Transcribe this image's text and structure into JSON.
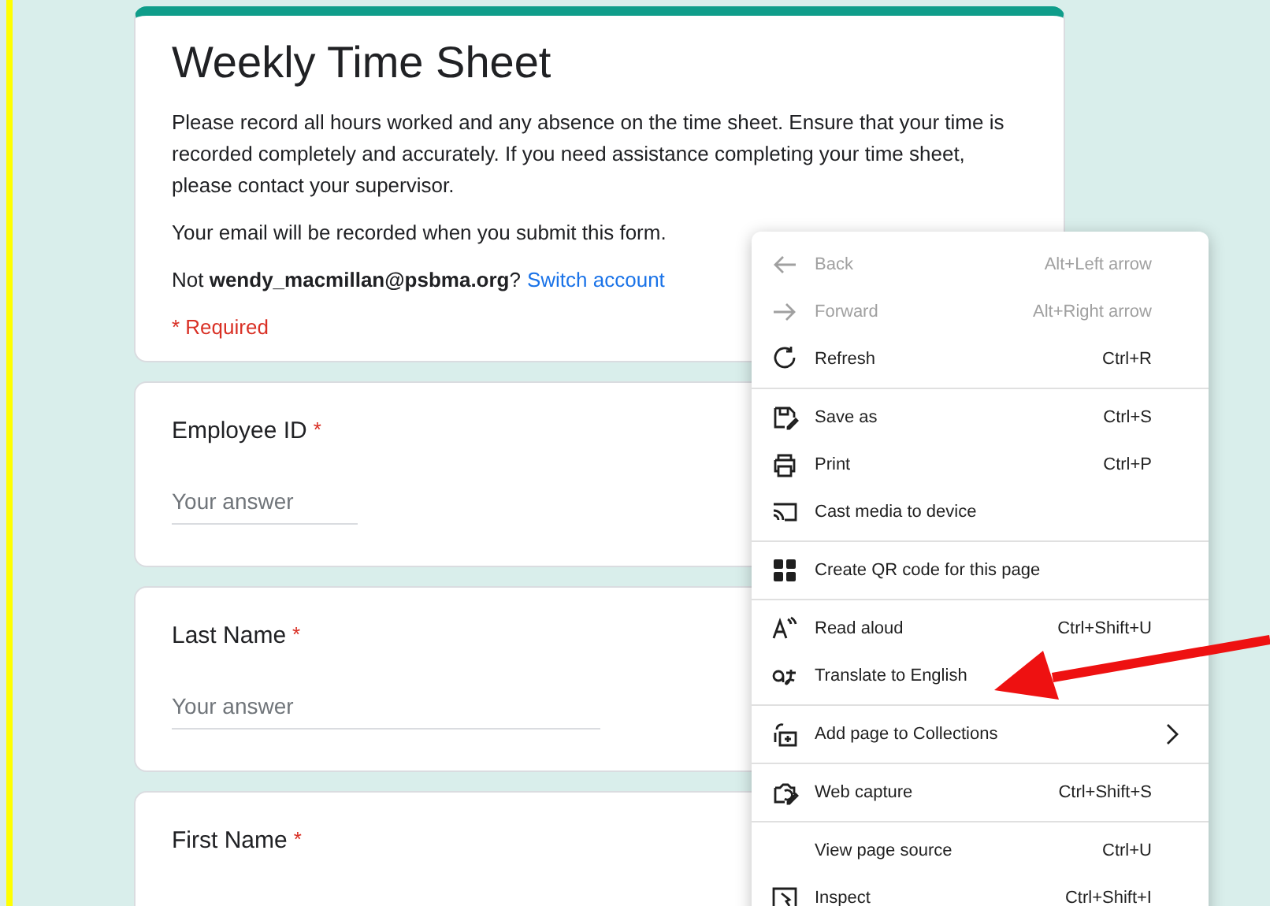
{
  "form": {
    "title": "Weekly Time Sheet",
    "description": "Please record all hours worked and any absence on the time sheet.  Ensure that your time is recorded completely and accurately. If you need assistance completing your time sheet, please contact your supervisor.",
    "email_notice": "Your email will be recorded when you submit this form.",
    "account_prefix": "Not **wendy_macmillan@psbma.org**?",
    "switch_link": "Switch account",
    "required_note": "* Required",
    "questions": [
      {
        "label": "Employee ID",
        "required": true,
        "placeholder": "Your answer",
        "kind": "short"
      },
      {
        "label": "Last Name",
        "required": true,
        "placeholder": "Your answer",
        "kind": "long"
      },
      {
        "label": "First Name",
        "required": true,
        "kind": "cut"
      }
    ]
  },
  "required_mark": "*",
  "context_menu": {
    "sections": [
      [
        {
          "label": "Back",
          "shortcut": "Alt+Left arrow",
          "disabled": true
        },
        {
          "label": "Forward",
          "shortcut": "Alt+Right arrow",
          "disabled": true
        },
        {
          "label": "Refresh",
          "shortcut": "Ctrl+R",
          "disabled": false
        }
      ],
      [
        {
          "label": "Save as",
          "shortcut": "Ctrl+S",
          "disabled": false
        },
        {
          "label": "Print",
          "shortcut": "Ctrl+P",
          "disabled": false
        },
        {
          "label": "Cast media to device",
          "disabled": false
        }
      ],
      [
        {
          "label": "Create QR code for this page",
          "disabled": false
        }
      ],
      [
        {
          "label": "Read aloud",
          "shortcut": "Ctrl+Shift+U",
          "disabled": false
        },
        {
          "label": "Translate to English",
          "disabled": false
        }
      ],
      [
        {
          "label": "Add page to Collections",
          "disabled": false,
          "submenu": true
        }
      ],
      [
        {
          "label": "Web capture",
          "shortcut": "Ctrl+Shift+S",
          "disabled": false
        }
      ],
      [
        {
          "label": "View page source",
          "shortcut": "Ctrl+U",
          "disabled": false
        },
        {
          "label": "Inspect",
          "shortcut": "Ctrl+Shift+I",
          "disabled": false
        }
      ]
    ]
  }
}
